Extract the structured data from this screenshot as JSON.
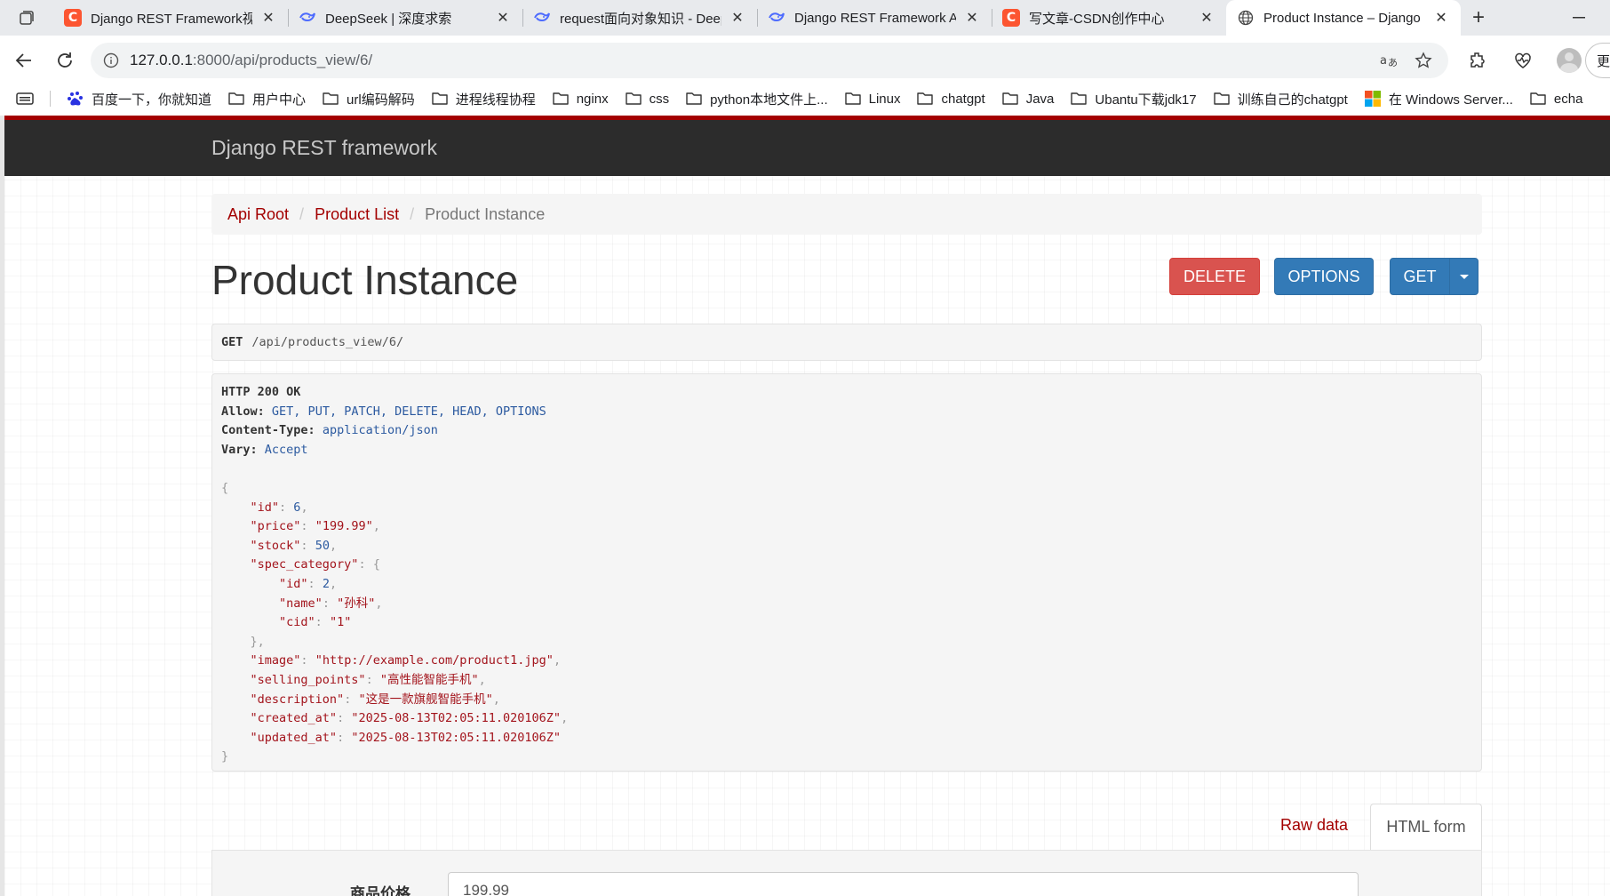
{
  "browser": {
    "tabs": [
      {
        "title": "Django REST Framework视图",
        "favicon": "csdn-icon",
        "active": false
      },
      {
        "title": "DeepSeek | 深度求索",
        "favicon": "deepseek-icon",
        "active": false
      },
      {
        "title": "request面向对象知识 - Deep",
        "favicon": "deepseek-icon",
        "active": false
      },
      {
        "title": "Django REST Framework API",
        "favicon": "deepseek-icon",
        "active": false
      },
      {
        "title": "写文章-CSDN创作中心",
        "favicon": "csdn-icon",
        "active": false
      },
      {
        "title": "Product Instance – Django R",
        "favicon": "globe-icon",
        "active": true
      }
    ],
    "url_host": "127.0.0.1",
    "url_path": ":8000/api/products_view/6/",
    "more_label": "更多",
    "bookmarks": [
      {
        "label": "百度一下，你就知道",
        "icon": "baidu-icon"
      },
      {
        "label": "用户中心",
        "icon": "folder-icon"
      },
      {
        "label": "url编码解码",
        "icon": "folder-icon"
      },
      {
        "label": "进程线程协程",
        "icon": "folder-icon"
      },
      {
        "label": "nginx",
        "icon": "folder-icon"
      },
      {
        "label": "css",
        "icon": "folder-icon"
      },
      {
        "label": "python本地文件上...",
        "icon": "folder-icon"
      },
      {
        "label": "Linux",
        "icon": "folder-icon"
      },
      {
        "label": "chatgpt",
        "icon": "folder-icon"
      },
      {
        "label": "Java",
        "icon": "folder-icon"
      },
      {
        "label": "Ubantu下载jdk17",
        "icon": "folder-icon"
      },
      {
        "label": "训练自己的chatgpt",
        "icon": "folder-icon"
      },
      {
        "label": "在 Windows Server...",
        "icon": "windows-icon"
      },
      {
        "label": "echa",
        "icon": "folder-icon"
      }
    ]
  },
  "drf": {
    "brand": "Django REST framework",
    "breadcrumb": {
      "api_root": "Api Root",
      "product_list": "Product List",
      "current": "Product Instance"
    },
    "page_title": "Product Instance",
    "buttons": {
      "delete": "DELETE",
      "options": "OPTIONS",
      "get": "GET"
    },
    "request": {
      "method": "GET",
      "path": "/api/products_view/6/"
    },
    "response": {
      "status": "HTTP 200 OK",
      "headers": [
        {
          "key": "Allow:",
          "value": "GET, PUT, PATCH, DELETE, HEAD, OPTIONS"
        },
        {
          "key": "Content-Type:",
          "value": "application/json"
        },
        {
          "key": "Vary:",
          "value": "Accept"
        }
      ],
      "body": {
        "id": 6,
        "price": "199.99",
        "stock": 50,
        "spec_category": {
          "id": 2,
          "name": "孙科",
          "cid": "1"
        },
        "image": "http://example.com/product1.jpg",
        "selling_points": "高性能智能手机",
        "description": "这是一款旗舰智能手机",
        "created_at": "2025-08-13T02:05:11.020106Z",
        "updated_at": "2025-08-13T02:05:11.020106Z"
      }
    },
    "form_tabs": {
      "raw": "Raw data",
      "html": "HTML form"
    },
    "form": {
      "price_label": "商品价格",
      "price_value": "199.99"
    }
  },
  "colors": {
    "brand_red": "#a30000",
    "delete": "#d9534f",
    "primary": "#337ab7",
    "navbar": "#2c2c2c"
  }
}
